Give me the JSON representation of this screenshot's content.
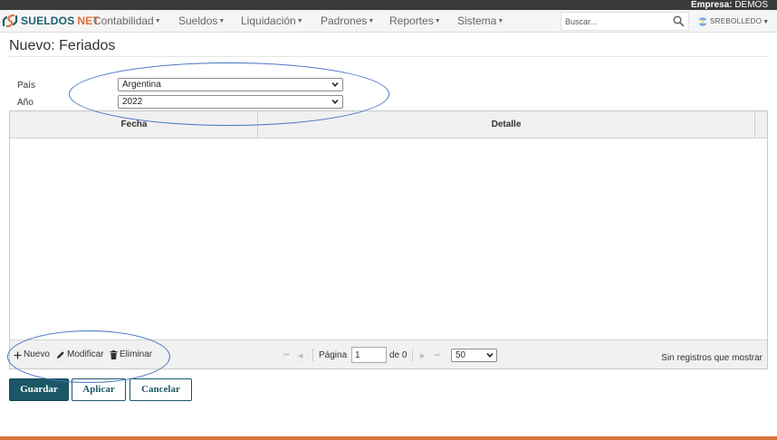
{
  "header": {
    "company_label": "Empresa:",
    "company_name": "DEMOS",
    "logo": {
      "text_main": "SUELDOS",
      "text_accent": "NET"
    },
    "menu": [
      {
        "label": "Contabilidad"
      },
      {
        "label": "Sueldos"
      },
      {
        "label": "Liquidación"
      },
      {
        "label": "Padrones"
      },
      {
        "label": "Reportes"
      },
      {
        "label": "Sistema"
      }
    ],
    "search": {
      "placeholder": "Buscar...",
      "icon": "search-icon"
    },
    "user": {
      "name": "SREBOLLEDO",
      "icon": "argentina-flag-icon"
    }
  },
  "page": {
    "title": "Nuevo: Feriados"
  },
  "form": {
    "pais": {
      "label": "País",
      "value": "Argentina"
    },
    "anio": {
      "label": "Año",
      "value": "2022"
    }
  },
  "grid": {
    "columns": [
      {
        "label": "Fecha"
      },
      {
        "label": "Detalle"
      }
    ],
    "rows": []
  },
  "toolbar": {
    "nuevo": {
      "label": "Nuevo",
      "icon": "plus-icon"
    },
    "modificar": {
      "label": "Modificar",
      "icon": "pencil-icon"
    },
    "eliminar": {
      "label": "Eliminar",
      "icon": "trash-icon"
    }
  },
  "pager": {
    "page_label": "Página",
    "page_value": "1",
    "of_label": "de 0",
    "page_size": "50",
    "empty_text": "Sin registros que mostrar"
  },
  "actions": {
    "guardar": "Guardar",
    "aplicar": "Aplicar",
    "cancelar": "Cancelar"
  },
  "colors": {
    "primary": "#1b5766",
    "accent": "#e0703b",
    "annotation": "#4472c4"
  }
}
